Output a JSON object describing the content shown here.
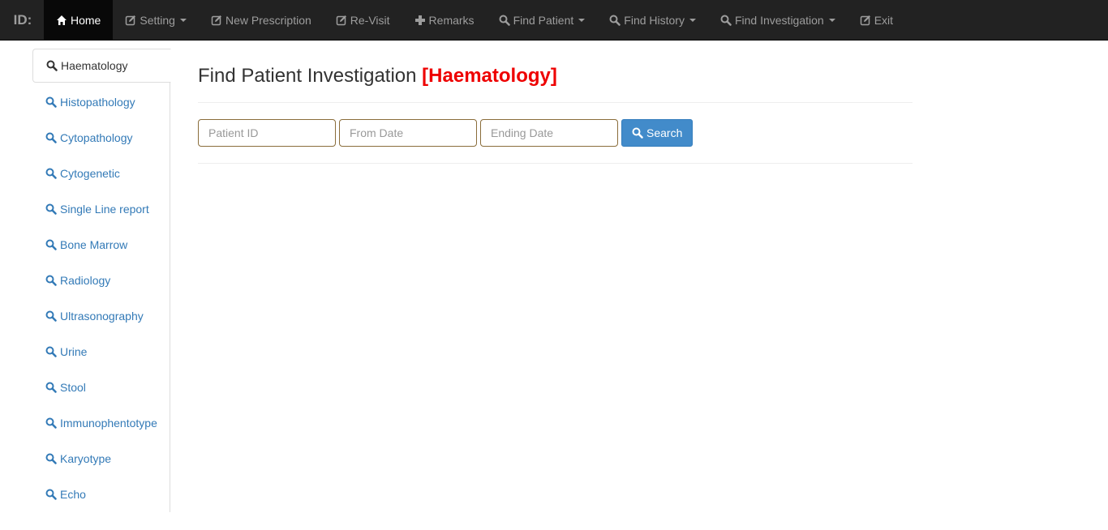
{
  "navbar": {
    "brand": "ID:",
    "items": [
      {
        "label": "Home",
        "icon": "home-icon"
      },
      {
        "label": "Setting",
        "icon": "edit-icon"
      },
      {
        "label": "New Prescription",
        "icon": "edit-icon"
      },
      {
        "label": "Re-Visit",
        "icon": "edit-icon"
      },
      {
        "label": "Remarks",
        "icon": "plus-icon"
      },
      {
        "label": "Find Patient",
        "icon": "search-icon"
      },
      {
        "label": "Find History",
        "icon": "search-icon"
      },
      {
        "label": "Find Investigation",
        "icon": "search-icon"
      },
      {
        "label": "Exit",
        "icon": "edit-icon"
      }
    ]
  },
  "sidebar": {
    "items": [
      {
        "label": "Haematology"
      },
      {
        "label": "Histopathology"
      },
      {
        "label": "Cytopathology"
      },
      {
        "label": "Cytogenetic"
      },
      {
        "label": "Single Line report"
      },
      {
        "label": "Bone Marrow"
      },
      {
        "label": "Radiology"
      },
      {
        "label": "Ultrasonography"
      },
      {
        "label": "Urine"
      },
      {
        "label": "Stool"
      },
      {
        "label": "Immunophentotype"
      },
      {
        "label": "Karyotype"
      },
      {
        "label": "Echo"
      }
    ]
  },
  "main": {
    "title": "Find Patient Investigation",
    "title_highlight": "[Haematology]",
    "patient_id_placeholder": "Patient ID",
    "from_date_placeholder": "From Date",
    "ending_date_placeholder": "Ending Date",
    "search_label": "Search"
  },
  "colors": {
    "navbar_bg": "#222222",
    "link": "#337ab7",
    "highlight": "#ee0000",
    "button": "#428bca",
    "input_border": "#8a6d3b"
  }
}
